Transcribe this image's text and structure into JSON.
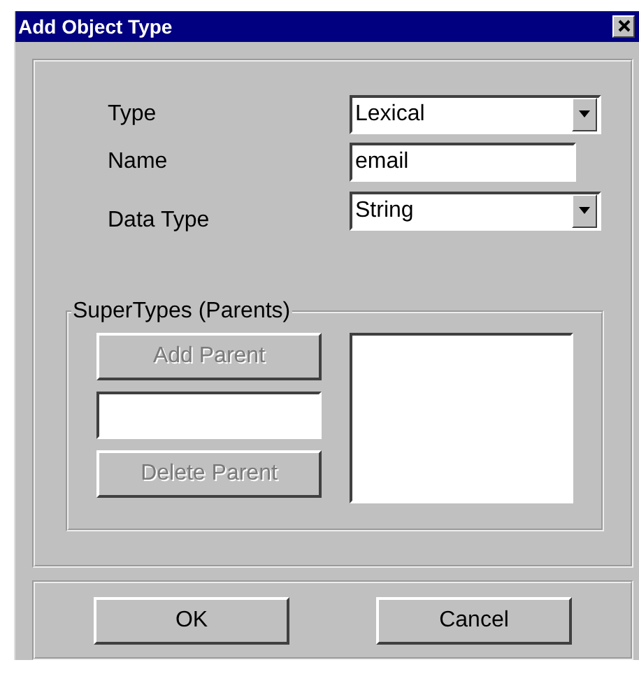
{
  "window": {
    "title": "Add Object Type"
  },
  "fields": [
    {
      "label": "Type",
      "kind": "dropdown",
      "value": "Lexical"
    },
    {
      "label": "Name",
      "kind": "text",
      "value": "email"
    },
    {
      "label": "Data Type",
      "kind": "dropdown",
      "value": "String"
    }
  ],
  "supertypes": {
    "title": "SuperTypes (Parents)",
    "add_button": {
      "label": "Add Parent",
      "disabled": true
    },
    "delete_button": {
      "label": "Delete Parent",
      "disabled": true
    }
  },
  "buttons": [
    {
      "label": "OK",
      "disabled": false
    },
    {
      "label": "Cancel",
      "disabled": false
    }
  ]
}
